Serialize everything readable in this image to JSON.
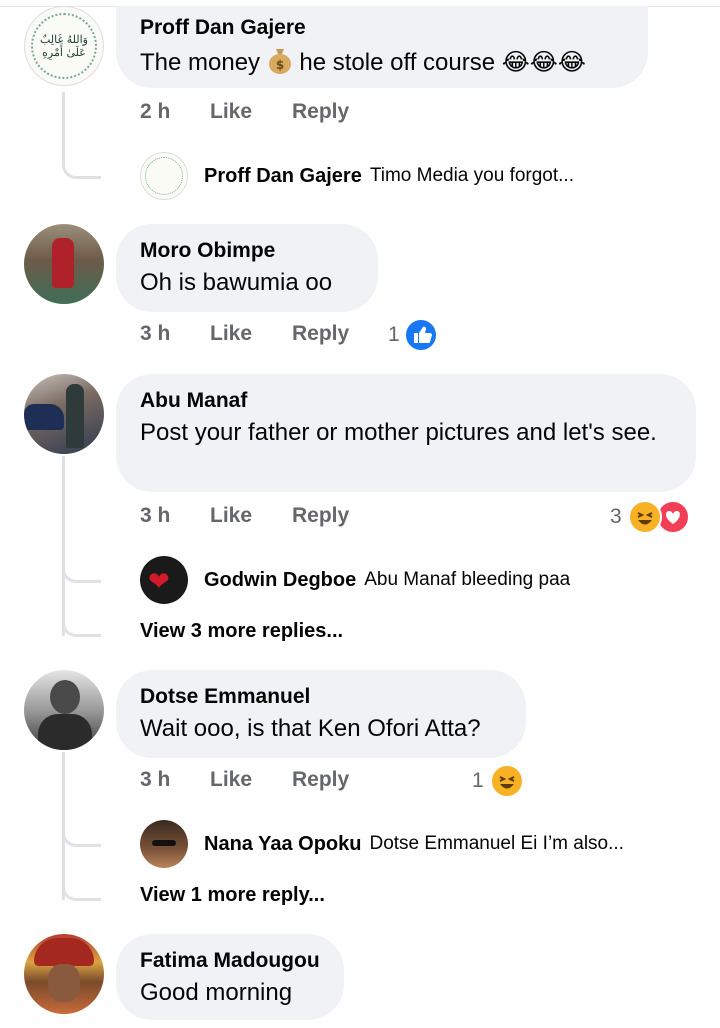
{
  "comments": [
    {
      "author": "Proff Dan Gajere",
      "text_before": "The money ",
      "text_after": " he stole off course ",
      "text_emoji": "😂😂😂",
      "inline_icon": "money-bag-icon",
      "time": "2 h",
      "like": "Like",
      "reply": "Reply",
      "avatar_text": "وَاللهُ غَالِبٌ عَلَىٰ أَمْرِهِ",
      "replies": [
        {
          "author": "Proff Dan Gajere",
          "text": "Timo Media you forgot..."
        }
      ]
    },
    {
      "author": "Moro Obimpe",
      "text": "Oh is bawumia oo",
      "time": "3 h",
      "like": "Like",
      "reply": "Reply",
      "reaction_count": "1",
      "reaction_icons": [
        "like-icon"
      ]
    },
    {
      "author": "Abu Manaf",
      "text": "Post your father or mother pictures and let's see.",
      "time": "3 h",
      "like": "Like",
      "reply": "Reply",
      "reaction_count": "3",
      "reaction_icons": [
        "haha-icon",
        "love-icon"
      ],
      "replies": [
        {
          "author": "Godwin Degboe",
          "text": "Abu Manaf bleeding paa"
        }
      ],
      "view_more": "View 3 more replies..."
    },
    {
      "author": "Dotse Emmanuel",
      "text": "Wait ooo, is that Ken Ofori Atta?",
      "time": "3 h",
      "like": "Like",
      "reply": "Reply",
      "reaction_count": "1",
      "reaction_icons": [
        "haha-icon"
      ],
      "replies": [
        {
          "author": "Nana Yaa Opoku",
          "text": "Dotse Emmanuel Ei I’m also..."
        }
      ],
      "view_more": "View 1 more reply..."
    },
    {
      "author": "Fatima Madougou",
      "text": "Good morning"
    }
  ],
  "colors": {
    "bubble": "#f0f2f5",
    "meta": "#65676b",
    "like_blue": "#1877f2",
    "love_red": "#f33e58",
    "haha_yellow": "#f7b125"
  }
}
